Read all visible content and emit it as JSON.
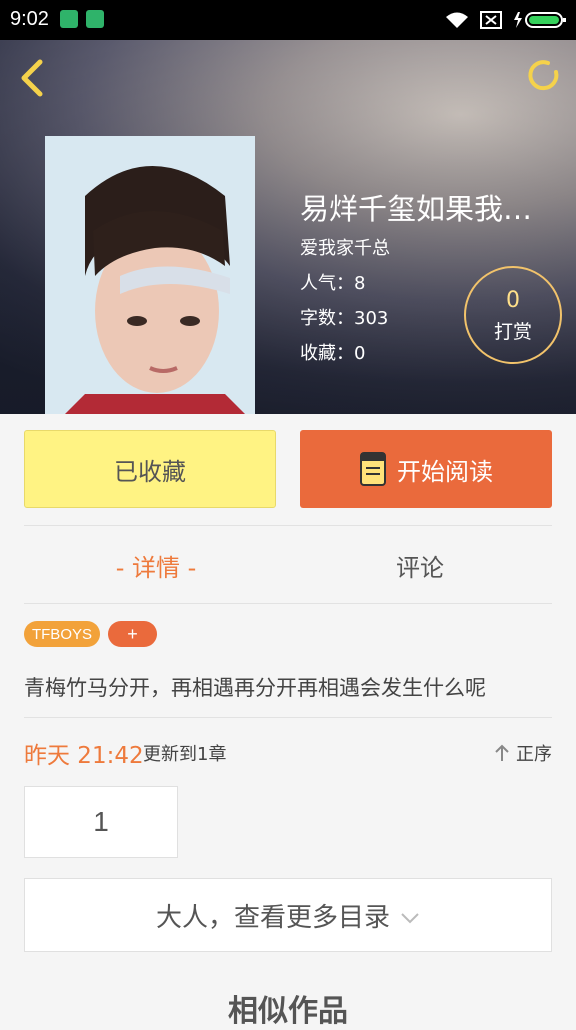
{
  "status_bar": {
    "time": "9:02"
  },
  "book": {
    "title": "易烊千玺如果我们…",
    "author": "爱我家千总",
    "popularity": "人气：8",
    "word_count": "字数：303",
    "favorites": "收藏：0",
    "tip_count": "0",
    "tip_label": "打赏"
  },
  "actions": {
    "favorite_label": "已收藏",
    "read_label": "开始阅读"
  },
  "tabs": [
    {
      "label": "- 详情 -"
    },
    {
      "label": "评论"
    }
  ],
  "tags": [
    "TFBOYS",
    "+"
  ],
  "description": "青梅竹马分开，再相遇再分开再相遇会发生什么呢",
  "update": {
    "time": "昨天 21:42",
    "text": "更新到1章",
    "order_label": "正序"
  },
  "chapters": [
    "1"
  ],
  "more_catalog_label": "大人，查看更多目录",
  "similar_title": "相似作品",
  "colors": {
    "accent": "#ea6a3c",
    "favorite_bg": "#fff383",
    "tag_primary": "#f2a23a",
    "tab_active": "#ee7a3c"
  }
}
